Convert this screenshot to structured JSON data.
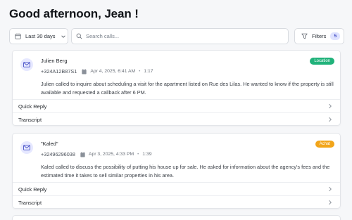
{
  "header": {
    "greeting": "Good afternoon, Jean !"
  },
  "toolbar": {
    "date_range": {
      "label": "Last 30 days",
      "icon": "calendar-icon"
    },
    "search": {
      "placeholder": "Search calls...",
      "value": "",
      "icon": "search-icon"
    },
    "filters": {
      "label": "Filters",
      "count": "5",
      "icon": "filter-icon"
    }
  },
  "calls": [
    {
      "caller": "Julien Berg",
      "phone": "+324A12B87S1",
      "date": "Apr 4, 2025, 6:41 AM",
      "duration": "1:17",
      "badge": "Location",
      "summary": "Julien called to inquire about scheduling a visit for the apartment listed on Rue des Lilas. He wanted to know if the property is still available and requested a callback after 6 PM.",
      "actions": [
        "Quick Reply",
        "Transcript"
      ]
    },
    {
      "caller": "\"Kaled\"",
      "phone": "+32496296038",
      "date": "Apr 3, 2025, 4:33 PM",
      "duration": "1:39",
      "badge": "Achat",
      "summary": "Kaled called to discuss the possibility of putting his house up for sale. He asked for information about the agency's fees and the estimated time it takes to sell similar properties in his area.",
      "actions": [
        "Quick Reply",
        "Transcript"
      ]
    }
  ],
  "colors": {
    "accent": "#3b46c2",
    "badge_location": "#20b27a",
    "badge_achat": "#f2a51a",
    "avatar_bg": "#e6e8ff"
  }
}
